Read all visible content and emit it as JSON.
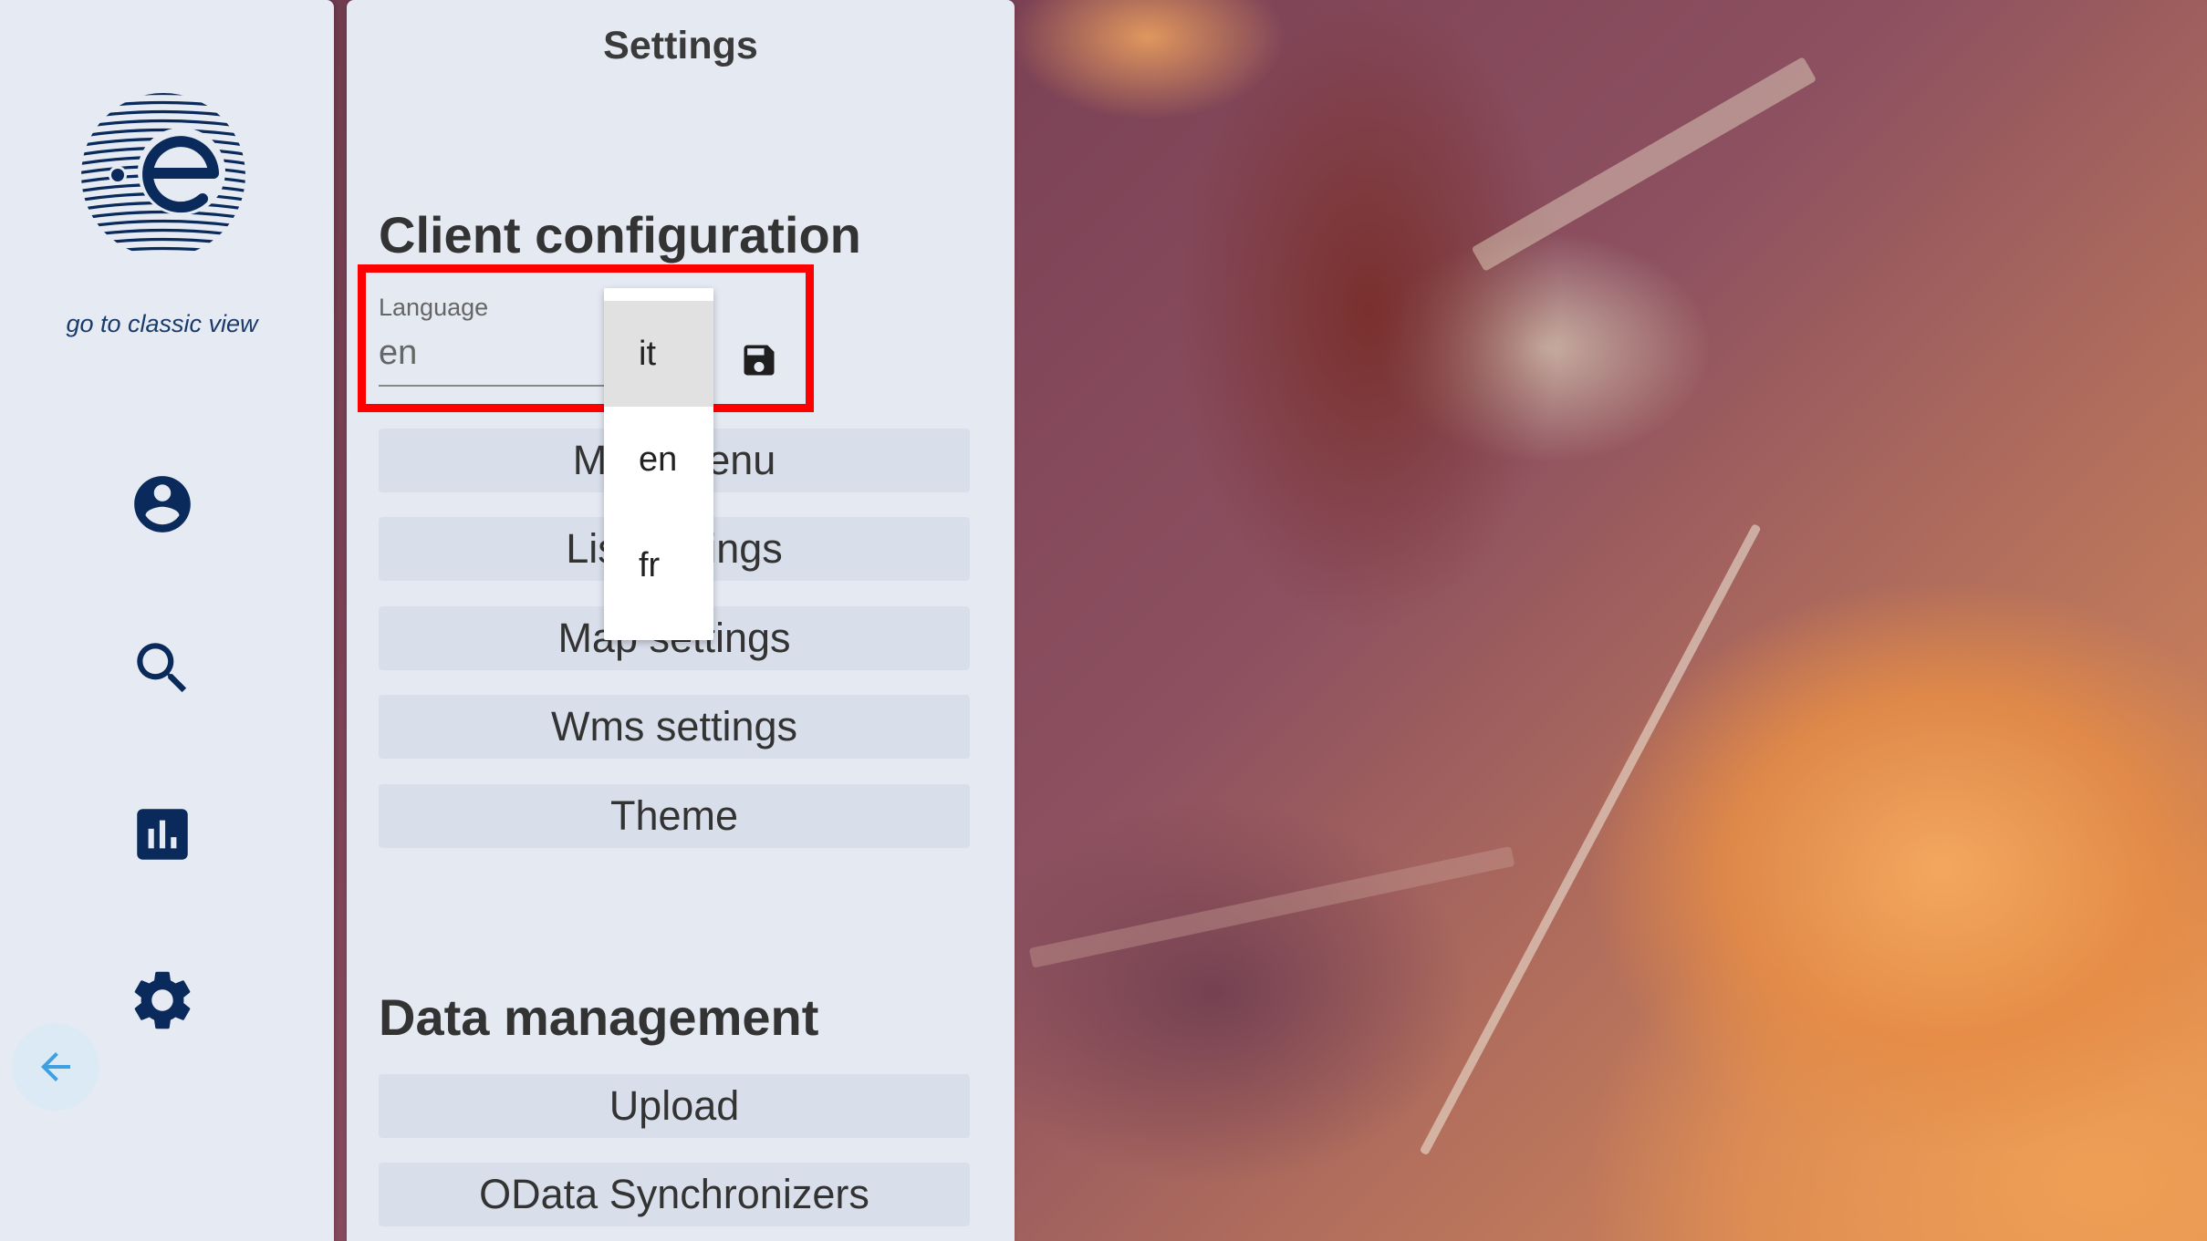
{
  "nav": {
    "classic_link": "go to classic view",
    "icons": [
      "account-icon",
      "search-icon",
      "chart-icon",
      "gear-icon"
    ],
    "back_icon": "arrow-left-icon"
  },
  "settings": {
    "title": "Settings",
    "client_heading": "Client configuration",
    "language": {
      "label": "Language",
      "value": "en",
      "options": [
        "it",
        "en",
        "fr"
      ],
      "highlighted_option": "it"
    },
    "client_buttons": [
      "Main menu",
      "List settings",
      "Map settings",
      "Wms settings",
      "Theme"
    ],
    "data_heading": "Data management",
    "data_buttons": [
      "Upload",
      "OData Synchronizers"
    ]
  },
  "colors": {
    "brand": "#0a2a5c",
    "highlight": "#ff0000"
  }
}
